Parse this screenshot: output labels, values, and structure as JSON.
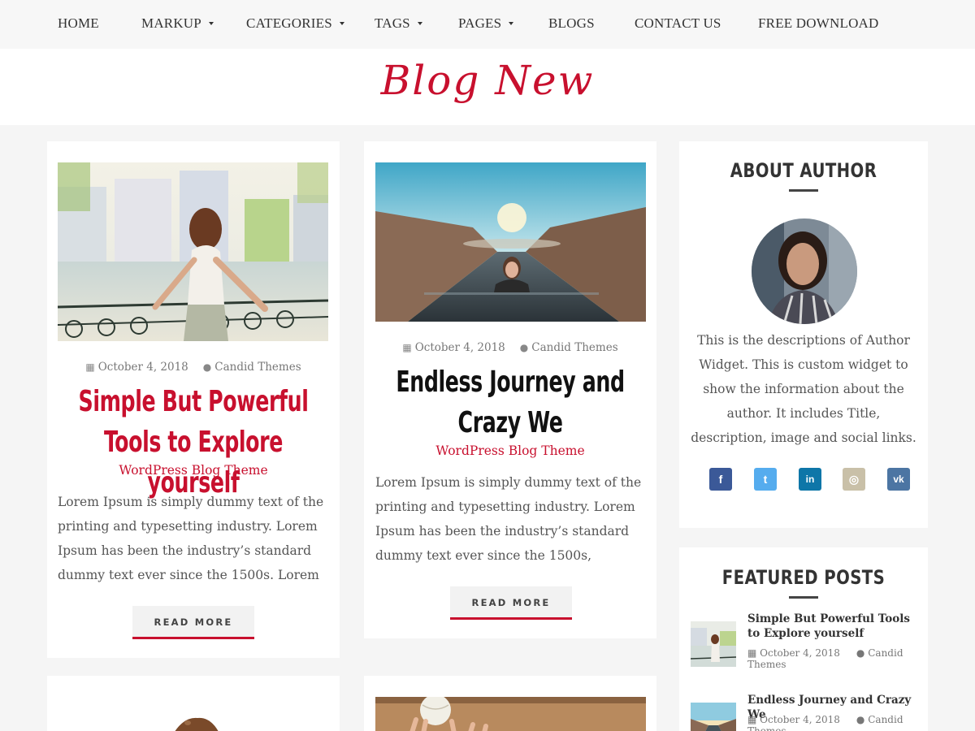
{
  "nav": {
    "items": [
      {
        "label": "HOME",
        "dropdown": false
      },
      {
        "label": "MARKUP",
        "dropdown": true
      },
      {
        "label": "CATEGORIES",
        "dropdown": true
      },
      {
        "label": "TAGS",
        "dropdown": true
      },
      {
        "label": "PAGES",
        "dropdown": true
      },
      {
        "label": "BLOGS",
        "dropdown": false
      },
      {
        "label": "CONTACT US",
        "dropdown": false
      },
      {
        "label": "FREE DOWNLOAD",
        "dropdown": false
      }
    ]
  },
  "site": {
    "title": "Blog New"
  },
  "posts": [
    {
      "date": "October 4, 2018",
      "author": "Candid Themes",
      "title": "Simple But Powerful Tools to Explore yourself",
      "category": "WordPress Blog Theme",
      "excerpt": "Lorem Ipsum is simply dummy text of the printing and typesetting industry. Lorem Ipsum has been the industry’s standard dummy text ever since the 1500s. Lorem",
      "read_more": "READ MORE"
    },
    {
      "date": "October 4, 2018",
      "author": "Candid Themes",
      "title": "Endless Journey and Crazy We",
      "category": "WordPress Blog Theme",
      "excerpt": "Lorem Ipsum is simply dummy text of the printing and typesetting industry. Lorem Ipsum has been the industry’s standard dummy text ever since the 1500s,",
      "read_more": "READ MORE"
    }
  ],
  "sidebar": {
    "about": {
      "title": "ABOUT AUTHOR",
      "description": "This is the descriptions of Author Widget. This is custom widget to show the information about the author. It includes Title, description, image and social links.",
      "social": [
        {
          "icon": "facebook-icon",
          "glyph": "f",
          "color": "#3b5998"
        },
        {
          "icon": "twitter-icon",
          "glyph": "t",
          "color": "#55acee"
        },
        {
          "icon": "linkedin-icon",
          "glyph": "in",
          "color": "#0e76a8"
        },
        {
          "icon": "instagram-icon",
          "glyph": "◎",
          "color": "#c9c0a8"
        },
        {
          "icon": "vk-icon",
          "glyph": "vk",
          "color": "#4c75a3"
        }
      ]
    },
    "featured": {
      "title": "FEATURED POSTS",
      "items": [
        {
          "title": "Simple But Powerful Tools to Explore yourself",
          "date": "October 4, 2018",
          "author": "Candid Themes"
        },
        {
          "title": "Endless Journey and Crazy We",
          "date": "October 4, 2018",
          "author": "Candid Themes"
        }
      ]
    }
  },
  "colors": {
    "accent": "#c8102e",
    "background": "#f5f5f5",
    "card": "#ffffff"
  }
}
